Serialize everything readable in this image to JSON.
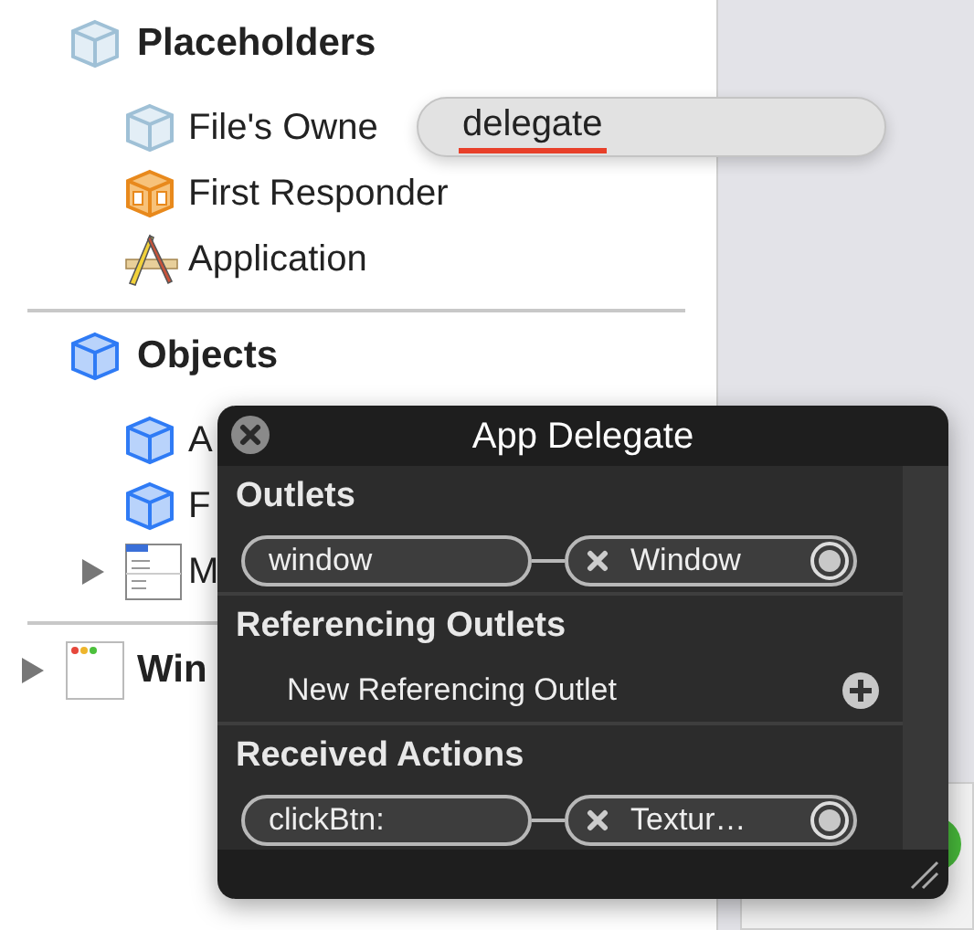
{
  "outline": [
    {
      "kind": "placeholders",
      "title": "Placeholders",
      "items": [
        {
          "kind": "placeholder",
          "label": "File's Owne"
        },
        {
          "kind": "responder",
          "label": "First Responder"
        },
        {
          "kind": "application",
          "label": "Application"
        }
      ]
    },
    {
      "kind": "objects",
      "title": "Objects",
      "items": [
        {
          "kind": "object",
          "label": "A"
        },
        {
          "kind": "object",
          "label": "F"
        },
        {
          "kind": "menu",
          "label": "M",
          "expanded": false
        }
      ]
    },
    {
      "kind": "window",
      "title": "Win",
      "expanded": false
    }
  ],
  "delegate_popup": {
    "text": "delegate"
  },
  "connections_panel": {
    "title": "App Delegate",
    "sections": [
      {
        "title": "Outlets",
        "rows": [
          {
            "kind": "connection",
            "name": "window",
            "target": "Window"
          }
        ]
      },
      {
        "title": "Referencing Outlets",
        "rows": [
          {
            "kind": "new",
            "name": "New Referencing Outlet"
          }
        ]
      },
      {
        "title": "Received Actions",
        "rows": [
          {
            "kind": "connection",
            "name": "clickBtn:",
            "target": "Textur…"
          }
        ]
      }
    ]
  }
}
